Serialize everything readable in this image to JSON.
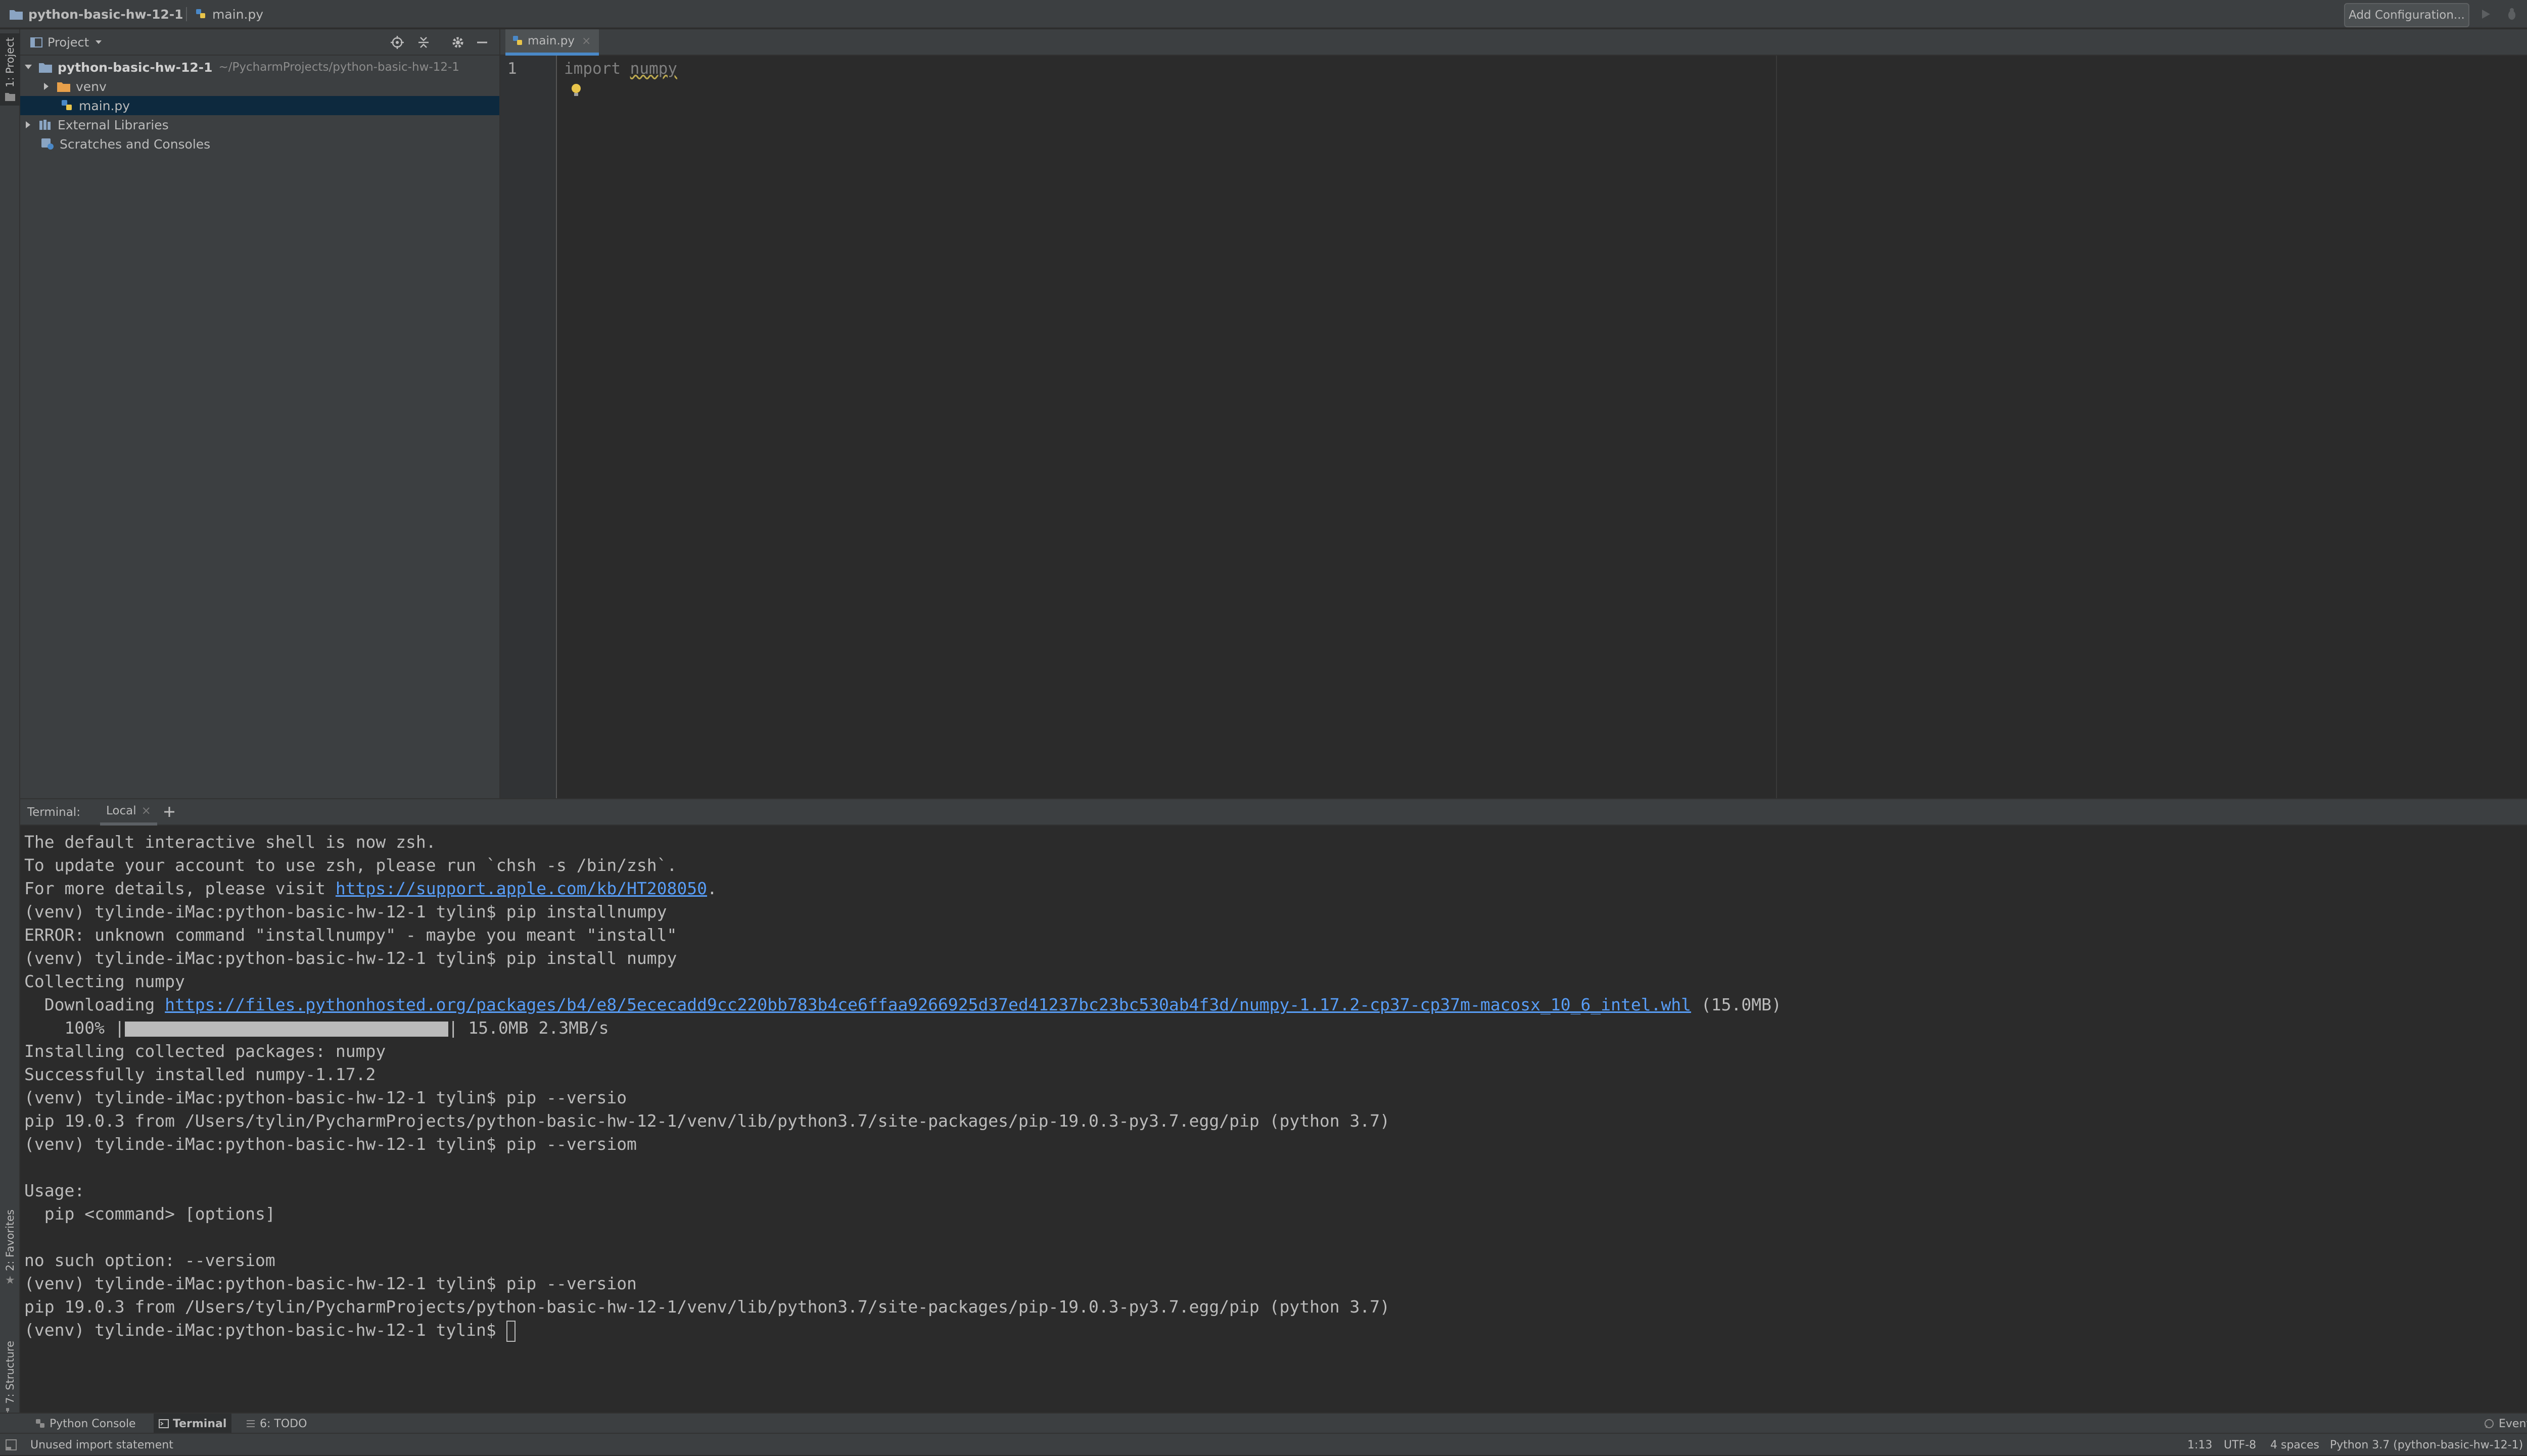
{
  "app": {
    "breadcrumb": [
      "python-basic-hw-12-1",
      "main.py"
    ],
    "run_config_label": "Add Configuration..."
  },
  "left_strip": {
    "project_tab": "1: Project",
    "favorites_tab": "2: Favorites",
    "structure_tab": "7: Structure"
  },
  "project_panel": {
    "view_selector": "Project",
    "tree": [
      {
        "label": "python-basic-hw-12-1",
        "hint": "~/PycharmProjects/python-basic-hw-12-1",
        "kind": "project-folder",
        "expanded": true,
        "level": 0
      },
      {
        "label": "venv",
        "kind": "excluded-folder",
        "expanded": false,
        "level": 1
      },
      {
        "label": "main.py",
        "kind": "python-file",
        "selected": true,
        "level": 1
      },
      {
        "label": "External Libraries",
        "kind": "library",
        "expanded": false,
        "level": 0
      },
      {
        "label": "Scratches and Consoles",
        "kind": "scratches",
        "level": 0
      }
    ]
  },
  "editor": {
    "tab_label": "main.py",
    "line_number": "1",
    "code": {
      "keyword": "import",
      "module": "numpy"
    }
  },
  "terminal": {
    "title": "Terminal:",
    "session_tab": "Local",
    "lines": [
      {
        "text": "The default interactive shell is now zsh."
      },
      {
        "text": "To update your account to use zsh, please run `chsh -s /bin/zsh`."
      },
      {
        "text": "For more details, please visit ",
        "link": "https://support.apple.com/kb/HT208050",
        "after": "."
      },
      {
        "text": "(venv) tylinde-iMac:python-basic-hw-12-1 tylin$ pip installnumpy"
      },
      {
        "text": "ERROR: unknown command \"installnumpy\" - maybe you meant \"install\""
      },
      {
        "text": "(venv) tylinde-iMac:python-basic-hw-12-1 tylin$ pip install numpy"
      },
      {
        "text": "Collecting numpy"
      },
      {
        "text": "  Downloading ",
        "link": "https://files.pythonhosted.org/packages/b4/e8/5ececadd9cc220bb783b4ce6ffaa9266925d37ed41237bc23bc530ab4f3d/numpy-1.17.2-cp37-cp37m-macosx_10_6_intel.whl",
        "after": " (15.0MB)"
      },
      {
        "progress": true,
        "text": "    100% |",
        "after": "| 15.0MB 2.3MB/s"
      },
      {
        "text": "Installing collected packages: numpy"
      },
      {
        "text": "Successfully installed numpy-1.17.2"
      },
      {
        "text": "(venv) tylinde-iMac:python-basic-hw-12-1 tylin$ pip --versio"
      },
      {
        "text": "pip 19.0.3 from /Users/tylin/PycharmProjects/python-basic-hw-12-1/venv/lib/python3.7/site-packages/pip-19.0.3-py3.7.egg/pip (python 3.7)"
      },
      {
        "text": "(venv) tylinde-iMac:python-basic-hw-12-1 tylin$ pip --versiom"
      },
      {
        "text": ""
      },
      {
        "text": "Usage:"
      },
      {
        "text": "  pip <command> [options]"
      },
      {
        "text": ""
      },
      {
        "text": "no such option: --versiom"
      },
      {
        "text": "(venv) tylinde-iMac:python-basic-hw-12-1 tylin$ pip --version"
      },
      {
        "text": "pip 19.0.3 from /Users/tylin/PycharmProjects/python-basic-hw-12-1/venv/lib/python3.7/site-packages/pip-19.0.3-py3.7.egg/pip (python 3.7)"
      },
      {
        "text": "(venv) tylinde-iMac:python-basic-hw-12-1 tylin$ ",
        "cursor": true
      }
    ]
  },
  "bottom_tabs": {
    "python_console": "Python Console",
    "terminal": "Terminal",
    "todo": "6: TODO",
    "event_log": "Event Log"
  },
  "status_bar": {
    "message": "Unused import statement",
    "position": "1:13",
    "encoding": "UTF-8",
    "indent": "4 spaces",
    "interpreter": "Python 3.7 (python-basic-hw-12-1)"
  },
  "colors": {
    "background": "#2b2b2b",
    "panel": "#3c3f41",
    "selection": "#0d293e",
    "accent": "#4a88c7",
    "link": "#589df6",
    "keyword": "#cc7832",
    "folder": "#e8a04a",
    "warning": "#bba850"
  },
  "icons": [
    "folder-icon",
    "python-file-icon",
    "library-icon",
    "scratches-icon",
    "locate-icon",
    "collapse-icon",
    "gear-icon",
    "minimize-icon",
    "run-icon",
    "debug-icon",
    "stop-icon",
    "search-icon",
    "bulb-icon",
    "add-icon",
    "close-icon"
  ]
}
